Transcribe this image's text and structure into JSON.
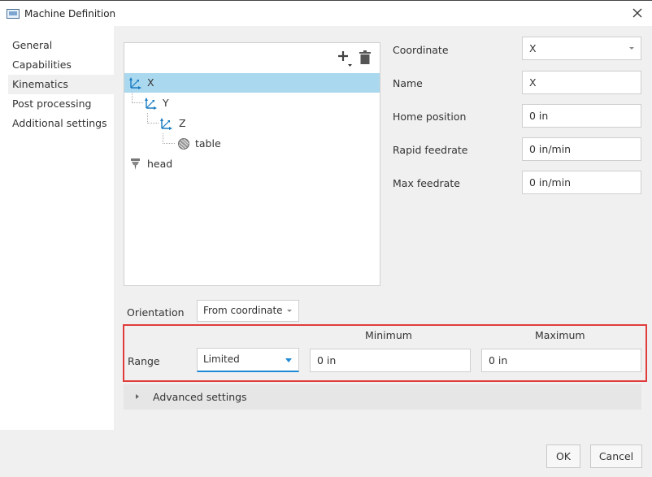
{
  "window": {
    "title": "Machine Definition"
  },
  "sidebar": {
    "items": [
      {
        "label": "General"
      },
      {
        "label": "Capabilities"
      },
      {
        "label": "Kinematics"
      },
      {
        "label": "Post processing"
      },
      {
        "label": "Additional settings"
      }
    ],
    "active": "Kinematics"
  },
  "tree": {
    "nodes": [
      {
        "label": "X",
        "icon": "axis-icon"
      },
      {
        "label": "Y",
        "icon": "axis-icon"
      },
      {
        "label": "Z",
        "icon": "axis-icon"
      },
      {
        "label": "table",
        "icon": "table-icon"
      },
      {
        "label": "head",
        "icon": "head-icon"
      }
    ],
    "selected": "X"
  },
  "properties": {
    "coordinate": {
      "label": "Coordinate",
      "value": "X"
    },
    "name": {
      "label": "Name",
      "value": "X"
    },
    "home_position": {
      "label": "Home position",
      "value": "0 in"
    },
    "rapid_feedrate": {
      "label": "Rapid feedrate",
      "value": "0 in/min"
    },
    "max_feedrate": {
      "label": "Max feedrate",
      "value": "0 in/min"
    }
  },
  "orientation": {
    "label": "Orientation",
    "value": "From coordinate"
  },
  "range": {
    "label": "Range",
    "value": "Limited",
    "minimum_label": "Minimum",
    "maximum_label": "Maximum",
    "minimum_value": "0 in",
    "maximum_value": "0 in"
  },
  "advanced": {
    "label": "Advanced settings"
  },
  "buttons": {
    "ok": "OK",
    "cancel": "Cancel"
  },
  "colors": {
    "selection": "#aad8ef",
    "accent": "#1d8ad6",
    "highlight_box": "#e03c3c"
  }
}
